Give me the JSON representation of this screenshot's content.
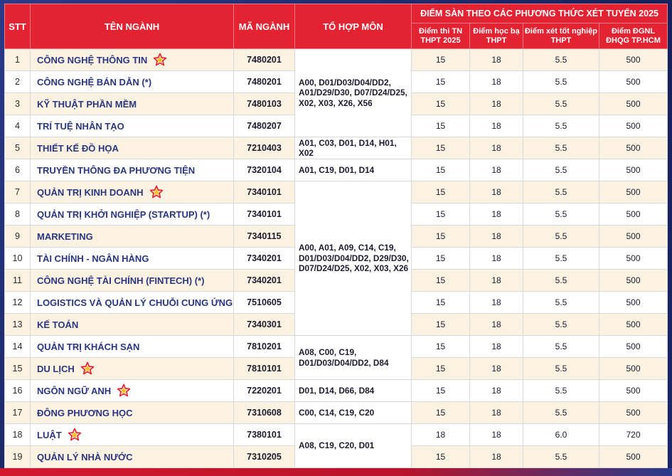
{
  "headers": {
    "stt": "STT",
    "name": "TÊN NGÀNH",
    "code": "MÃ NGÀNH",
    "combo": "TỔ HỢP MÔN",
    "group": "ĐIỂM SÀN THEO CÁC PHƯƠNG THỨC XÉT TUYỂN 2025",
    "sub1": "Điểm thi TN THPT 2025",
    "sub2": "Điểm học bạ THPT",
    "sub3": "Điểm xét tốt nghiệp THPT",
    "sub4": "Điểm ĐGNL ĐHQG TP.HCM"
  },
  "colors": {
    "header_red": "#e32332",
    "name_blue": "#2a3680",
    "row_shade": "#fbf2e2",
    "star": "#e32332"
  },
  "combos": {
    "g1": "A00, D01/D03/D04/DD2, A01/D29/D30, D07/D24/D25, X02, X03, X26, X56",
    "g2": "A01, C03, D01, D14, H01, X02",
    "g3": "A01, C19, D01, D14",
    "g4": "A00, A01, A09, C14, C19, D01/D03/D04/DD2, D29/D30, D07/D24/D25, X02, X03, X26",
    "g5": "A08, C00, C19, D01/D03/D04/DD2, D84",
    "g6": "D01, D14, D66, D84",
    "g7": "C00, C14, C19, C20",
    "g8": "A08, C19, C20, D01"
  },
  "rows": [
    {
      "stt": "1",
      "name": "CÔNG NGHỆ THÔNG TIN",
      "star": true,
      "code": "7480201",
      "s1": "15",
      "s2": "18",
      "s3": "5.5",
      "s4": "500"
    },
    {
      "stt": "2",
      "name": "CÔNG NGHỆ BÁN DẪN (*)",
      "star": false,
      "code": "7480201",
      "s1": "15",
      "s2": "18",
      "s3": "5.5",
      "s4": "500"
    },
    {
      "stt": "3",
      "name": "KỸ THUẬT PHẦN MỀM",
      "star": false,
      "code": "7480103",
      "s1": "15",
      "s2": "18",
      "s3": "5.5",
      "s4": "500"
    },
    {
      "stt": "4",
      "name": "TRÍ TUỆ NHÂN TẠO",
      "star": false,
      "code": "7480207",
      "s1": "15",
      "s2": "18",
      "s3": "5.5",
      "s4": "500"
    },
    {
      "stt": "5",
      "name": "THIẾT KẾ ĐỒ HỌA",
      "star": false,
      "code": "7210403",
      "s1": "15",
      "s2": "18",
      "s3": "5.5",
      "s4": "500"
    },
    {
      "stt": "6",
      "name": "TRUYỀN THÔNG ĐA PHƯƠNG TIỆN",
      "star": false,
      "code": "7320104",
      "s1": "15",
      "s2": "18",
      "s3": "5.5",
      "s4": "500"
    },
    {
      "stt": "7",
      "name": "QUẢN TRỊ KINH DOANH",
      "star": true,
      "code": "7340101",
      "s1": "15",
      "s2": "18",
      "s3": "5.5",
      "s4": "500"
    },
    {
      "stt": "8",
      "name": "QUẢN TRỊ KHỞI NGHIỆP (STARTUP) (*)",
      "star": false,
      "code": "7340101",
      "s1": "15",
      "s2": "18",
      "s3": "5.5",
      "s4": "500"
    },
    {
      "stt": "9",
      "name": "MARKETING",
      "star": false,
      "code": "7340115",
      "s1": "15",
      "s2": "18",
      "s3": "5.5",
      "s4": "500"
    },
    {
      "stt": "10",
      "name": "TÀI CHÍNH - NGÂN HÀNG",
      "star": false,
      "code": "7340201",
      "s1": "15",
      "s2": "18",
      "s3": "5.5",
      "s4": "500"
    },
    {
      "stt": "11",
      "name": "CÔNG NGHỆ TÀI CHÍNH (FINTECH) (*)",
      "star": false,
      "code": "7340201",
      "s1": "15",
      "s2": "18",
      "s3": "5.5",
      "s4": "500"
    },
    {
      "stt": "12",
      "name": "LOGISTICS VÀ QUẢN LÝ CHUỖI CUNG ỨNG",
      "star": false,
      "code": "7510605",
      "s1": "15",
      "s2": "18",
      "s3": "5.5",
      "s4": "500"
    },
    {
      "stt": "13",
      "name": "KẾ TOÁN",
      "star": false,
      "code": "7340301",
      "s1": "15",
      "s2": "18",
      "s3": "5.5",
      "s4": "500"
    },
    {
      "stt": "14",
      "name": "QUẢN TRỊ KHÁCH SẠN",
      "star": false,
      "code": "7810201",
      "s1": "15",
      "s2": "18",
      "s3": "5.5",
      "s4": "500"
    },
    {
      "stt": "15",
      "name": "DU LỊCH",
      "star": true,
      "code": "7810101",
      "s1": "15",
      "s2": "18",
      "s3": "5.5",
      "s4": "500"
    },
    {
      "stt": "16",
      "name": "NGÔN NGỮ ANH",
      "star": true,
      "code": "7220201",
      "s1": "15",
      "s2": "18",
      "s3": "5.5",
      "s4": "500"
    },
    {
      "stt": "17",
      "name": "ĐÔNG PHƯƠNG HỌC",
      "star": false,
      "code": "7310608",
      "s1": "15",
      "s2": "18",
      "s3": "5.5",
      "s4": "500"
    },
    {
      "stt": "18",
      "name": "LUẬT",
      "star": true,
      "code": "7380101",
      "s1": "18",
      "s2": "18",
      "s3": "6.0",
      "s4": "720"
    },
    {
      "stt": "19",
      "name": "QUẢN LÝ NHÀ NƯỚC",
      "star": false,
      "code": "7310205",
      "s1": "15",
      "s2": "18",
      "s3": "5.5",
      "s4": "500"
    }
  ]
}
